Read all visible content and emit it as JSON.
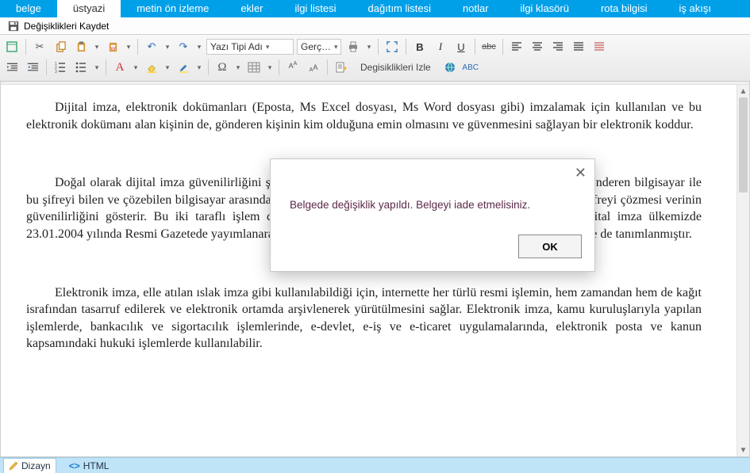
{
  "top_tabs": {
    "items": [
      {
        "label": "belge"
      },
      {
        "label": "üstyazi"
      },
      {
        "label": "metin ön izleme"
      },
      {
        "label": "ekler"
      },
      {
        "label": "ilgi listesi"
      },
      {
        "label": "dağıtım listesi"
      },
      {
        "label": "notlar"
      },
      {
        "label": "ilgi klasörü"
      },
      {
        "label": "rota bilgisi"
      },
      {
        "label": "iş akışı"
      }
    ],
    "active_index": 1
  },
  "save_bar": {
    "label": "Değişiklikleri Kaydet"
  },
  "toolbar": {
    "font_name": "Yazı Tipi Adı",
    "font_size": "Gerç…",
    "track_changes": "Degisiklikleri Izle",
    "bold": "B",
    "italic": "I",
    "underline": "U",
    "strike": "abc",
    "letter_A": "A",
    "omega": "Ω"
  },
  "document": {
    "p1": "Dijital imza, elektronik dokümanları (Eposta, Ms Excel dosyası, Ms Word dosyası gibi) imzalamak için kullanılan ve bu elektronik dokümanı alan kişinin de, gönderen kişinin kim olduğuna emin olmasını ve güvenmesini sağlayan bir elektronik koddur.",
    "p2": "Doğal olarak dijital imza güvenilirliğini şifreleme teknolojisinden alır. Gönderici, şifrelenmiş verileri gönderen bilgisayar ile bu şifreyi bilen ve çözebilen bilgisayar arasında iletir. Gönderenin şifreleme işlemi ile alıcının doğru şekilde şifreyi çözmesi verinin güvenilirliğini gösterir. Bu iki taraflı işlem dijital imzayı tanımlar ve güvenlik altyapısını oluşturur. Dijital imza ülkemizde 23.01.2004 yılında Resmi Gazetede yayımlanarak yürürlüğe girmiş olan 5070 sayılı Elektronik İmza Kanunu ile de tanımlanmıştır.",
    "p3": "Elektronik imza, elle atılan ıslak imza gibi kullanılabildiği için, internette her türlü resmi işlemin, hem zamandan hem de kağıt israfından tasarruf edilerek ve elektronik ortamda arşivlenerek yürütülmesini sağlar. Elektronik imza, kamu kuruluşlarıyla yapılan işlemlerde, bankacılık ve sigortacılık işlemlerinde, e-devlet, e-iş ve e-ticaret uygulamalarında, elektronik posta ve kanun kapsamındaki hukuki işlemlerde kullanılabilir."
  },
  "modal": {
    "message": "Belgede değişiklik yapıldı. Belgeyi iade etmelisiniz.",
    "ok": "OK"
  },
  "mode_tabs": {
    "design": "Dizayn",
    "html": "HTML"
  }
}
